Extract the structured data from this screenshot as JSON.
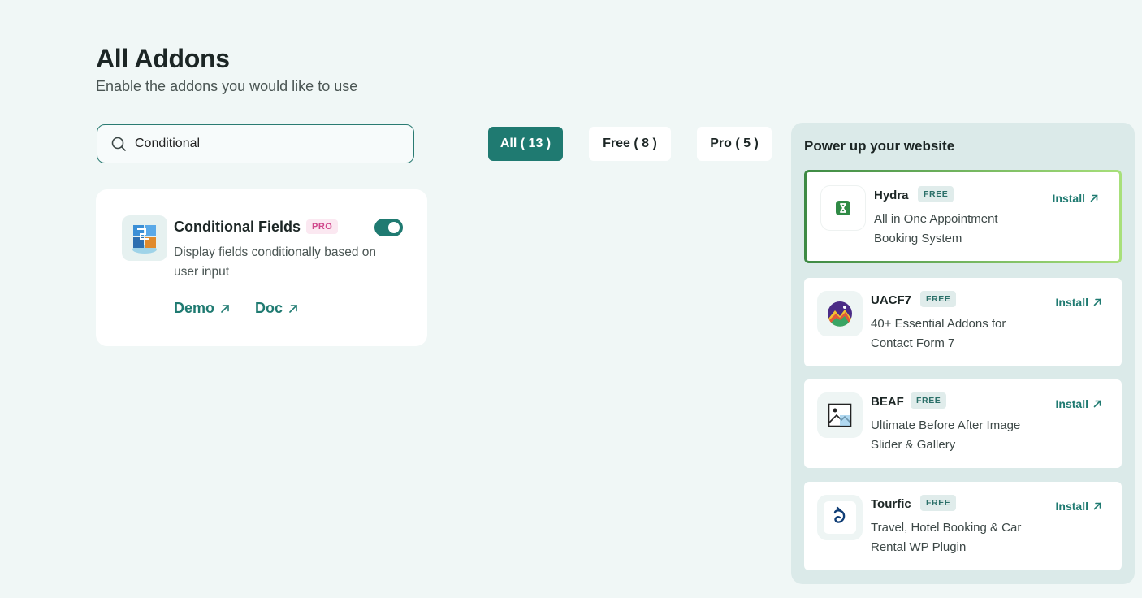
{
  "header": {
    "title": "All Addons",
    "subtitle": "Enable the addons you would like to use"
  },
  "search": {
    "value": "Conditional",
    "placeholder": ""
  },
  "filters": {
    "all": "All ( 13 )",
    "free": "Free ( 8 )",
    "pro": "Pro ( 5 )"
  },
  "addon": {
    "name": "Conditional Fields",
    "badge": "PRO",
    "description": "Display fields conditionally based on user input",
    "enabled": true,
    "demo_label": "Demo",
    "doc_label": "Doc"
  },
  "side_panel": {
    "title": "Power up your website",
    "install_label": "Install",
    "plugins": [
      {
        "name": "Hydra",
        "badge": "FREE",
        "description": "All in One Appointment Booking System",
        "icon": "hydra-icon"
      },
      {
        "name": "UACF7",
        "badge": "FREE",
        "description": "40+ Essential Addons for Contact Form 7",
        "icon": "uacf7-icon"
      },
      {
        "name": "BEAF",
        "badge": "FREE",
        "description": "Ultimate Before After Image Slider & Gallery",
        "icon": "beaf-icon"
      },
      {
        "name": "Tourfic",
        "badge": "FREE",
        "description": "Travel, Hotel Booking & Car Rental WP Plugin",
        "icon": "tourfic-icon"
      }
    ]
  },
  "colors": {
    "accent": "#1f7a71",
    "background": "#f0f7f6",
    "pro_badge": "#d0478c"
  }
}
